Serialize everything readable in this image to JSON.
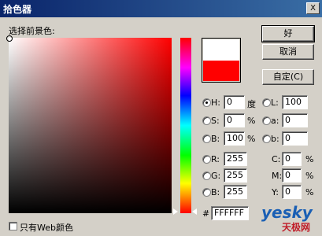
{
  "window": {
    "title": "拾色器",
    "close_glyph": "X"
  },
  "label_pick": "选择前景色:",
  "buttons": {
    "ok": "好",
    "cancel": "取消",
    "custom": "自定(C)"
  },
  "hsb": {
    "h_label": "H:",
    "h_value": "0",
    "h_unit": "度",
    "s_label": "S:",
    "s_value": "0",
    "s_unit": "%",
    "b_label": "B:",
    "b_value": "100",
    "b_unit": "%"
  },
  "lab": {
    "l_label": "L:",
    "l_value": "100",
    "a_label": "a:",
    "a_value": "0",
    "b_label": "b:",
    "b_value": "0"
  },
  "rgb": {
    "r_label": "R:",
    "r_value": "255",
    "g_label": "G:",
    "g_value": "255",
    "b_label": "B:",
    "b_value": "255"
  },
  "cmyk": {
    "c_label": "C:",
    "c_value": "0",
    "m_label": "M:",
    "m_value": "0",
    "y_label": "Y:",
    "y_value": "0",
    "k_label": "K:",
    "k_value": "0",
    "unit": "%"
  },
  "hex": {
    "label": "#",
    "value": "FFFFFF"
  },
  "web_only": {
    "label": "只有Web颜色",
    "checked": false
  },
  "colors": {
    "new_color": "#ffffff",
    "current_color": "#ff0000",
    "accent": "#0a246a"
  },
  "watermark": {
    "line1": "yesky",
    "line2": "天极网"
  }
}
